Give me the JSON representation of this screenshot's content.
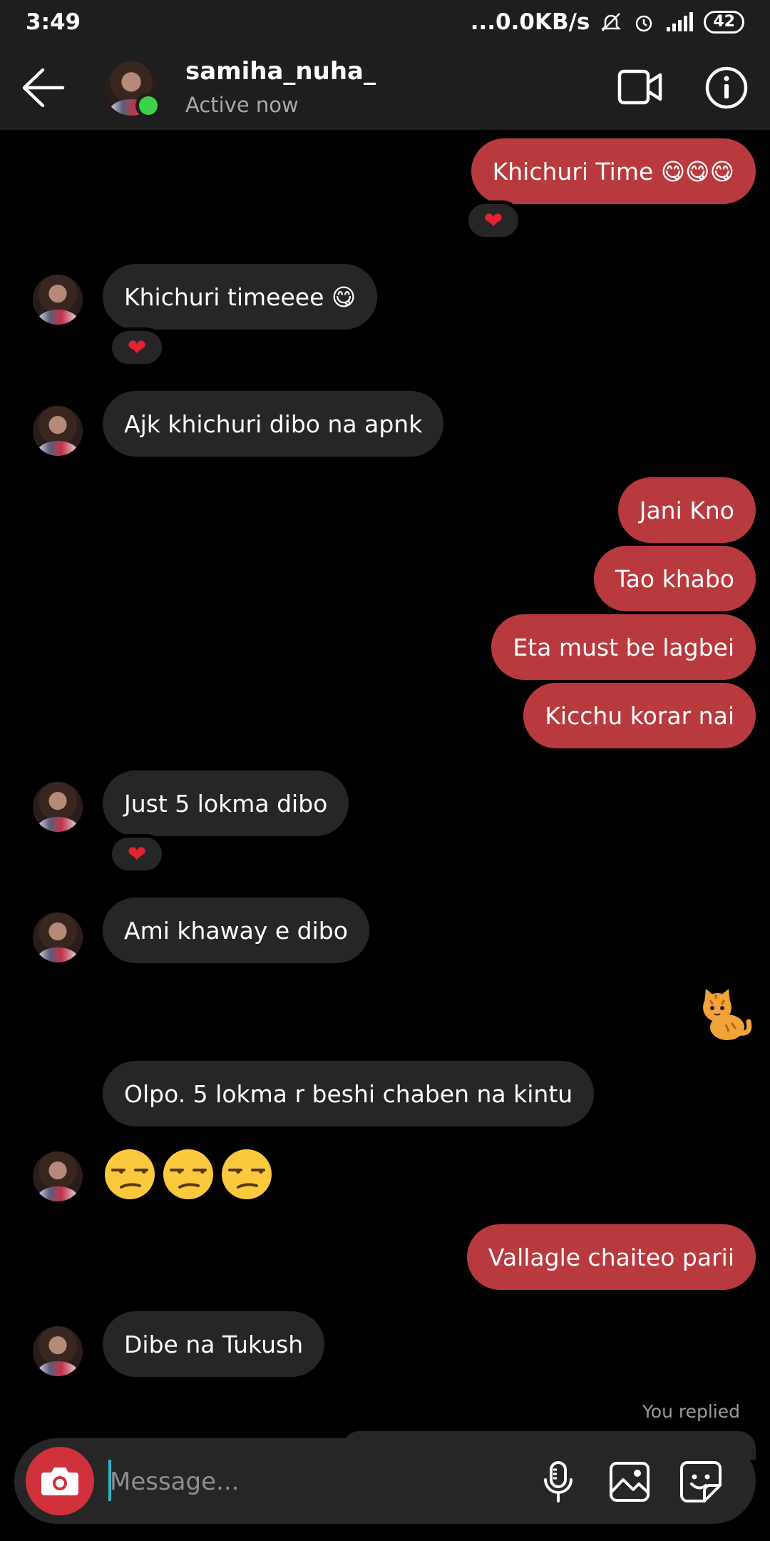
{
  "status_bar": {
    "time": "3:49",
    "net_speed": "...0.0KB/s",
    "battery": "42"
  },
  "header": {
    "username": "samiha_nuha_",
    "status": "Active now"
  },
  "messages": [
    {
      "from": "me",
      "text": "Khichuri Time 😋😋😋",
      "reaction": "❤"
    },
    {
      "from": "them",
      "text": "Khichuri timeeee 😋",
      "reaction": "❤"
    },
    {
      "from": "them",
      "text": "Ajk khichuri dibo na apnk"
    },
    {
      "from": "me",
      "text": "Jani Kno"
    },
    {
      "from": "me",
      "text": "Tao khabo"
    },
    {
      "from": "me",
      "text": "Eta must be lagbei"
    },
    {
      "from": "me",
      "text": "Kicchu korar nai"
    },
    {
      "from": "them",
      "text": "Just 5 lokma dibo",
      "reaction": "❤"
    },
    {
      "from": "them",
      "text": "Ami khaway e dibo"
    },
    {
      "from": "me",
      "sticker": "cat-emoji"
    },
    {
      "from": "them",
      "text": "Olpo. 5 lokma r beshi chaben na kintu"
    },
    {
      "from": "them",
      "emoji": "unamused-face",
      "count": 3
    },
    {
      "from": "me",
      "text": "Vallagle chaiteo parii"
    },
    {
      "from": "them",
      "text": "Dibe na Tukush"
    }
  ],
  "reply_label": "You replied",
  "composer": {
    "placeholder": "Message..."
  },
  "colors": {
    "sent_bubble": "#b93a3e",
    "received_bubble": "#262626",
    "online_dot": "#3ed14a",
    "camera_button": "#d1303d"
  }
}
